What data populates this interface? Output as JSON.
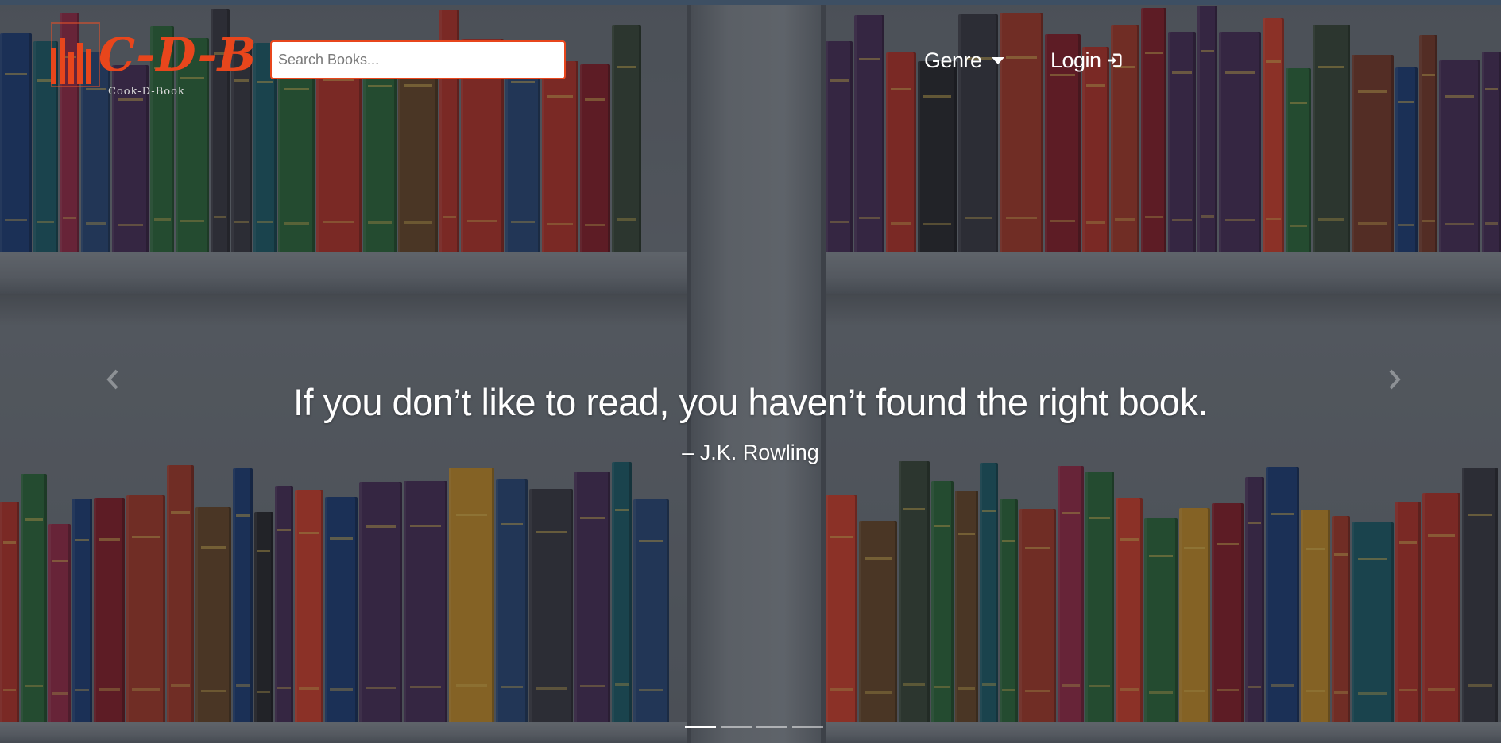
{
  "navbar": {
    "brand": {
      "letters": "C-D-B",
      "tagline": "Cook-D-Book",
      "accent_color": "#e8461c"
    },
    "search": {
      "placeholder": "Search Books...",
      "value": ""
    },
    "genre_label": "Genre",
    "login_label": "Login",
    "login_icon": "sign-in-icon",
    "genre_icon": "caret-down-icon"
  },
  "carousel": {
    "quote": "If you don’t like to read, you haven’t found the right book.",
    "author": "– J.K. Rowling",
    "slide_count": 4,
    "active_slide": 1,
    "prev_icon": "chevron-left-icon",
    "next_icon": "chevron-right-icon"
  },
  "colors": {
    "overlay": "rgba(20,24,30,0.38)",
    "text": "#ffffff"
  }
}
